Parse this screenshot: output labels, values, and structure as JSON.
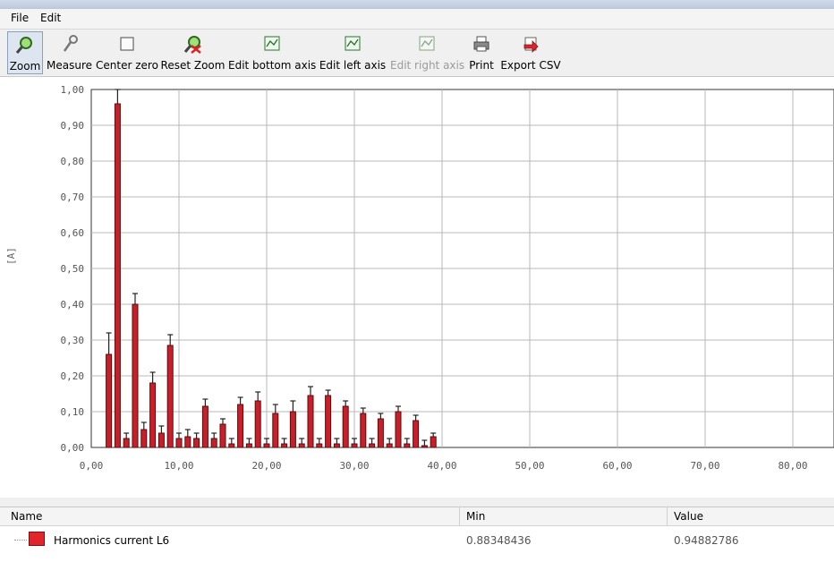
{
  "menu": {
    "file": "File",
    "edit": "Edit"
  },
  "toolbar": {
    "zoom": "Zoom",
    "measure": "Measure",
    "center_zero": "Center zero",
    "reset_zoom": "Reset Zoom",
    "edit_bottom_axis": "Edit bottom axis",
    "edit_left_axis": "Edit left axis",
    "edit_right_axis": "Edit right axis",
    "print": "Print",
    "export_csv": "Export CSV"
  },
  "chart_data": {
    "type": "bar",
    "ylabel": "[A]",
    "xlim": [
      0,
      85
    ],
    "ylim": [
      0,
      1.0
    ],
    "x_ticks": [
      "0,00",
      "10,00",
      "20,00",
      "30,00",
      "40,00",
      "50,00",
      "60,00",
      "70,00",
      "80,00"
    ],
    "y_ticks": [
      "0,00",
      "0,10",
      "0,20",
      "0,30",
      "0,40",
      "0,50",
      "0,60",
      "0,70",
      "0,80",
      "0,90",
      "1,00"
    ],
    "grid": true,
    "series": [
      {
        "name": "Harmonics current L6",
        "color": "#c8202a",
        "x": [
          2,
          3,
          4,
          5,
          6,
          7,
          8,
          9,
          10,
          11,
          12,
          13,
          14,
          15,
          16,
          17,
          18,
          19,
          20,
          21,
          22,
          23,
          24,
          25,
          26,
          27,
          28,
          29,
          30,
          31,
          32,
          33,
          34,
          35,
          36,
          37,
          38,
          39
        ],
        "values": [
          0.26,
          0.96,
          0.025,
          0.4,
          0.05,
          0.18,
          0.04,
          0.285,
          0.025,
          0.03,
          0.025,
          0.115,
          0.025,
          0.065,
          0.01,
          0.12,
          0.01,
          0.13,
          0.01,
          0.095,
          0.01,
          0.1,
          0.01,
          0.145,
          0.01,
          0.145,
          0.01,
          0.115,
          0.01,
          0.095,
          0.01,
          0.08,
          0.01,
          0.1,
          0.01,
          0.075,
          0.005,
          0.03
        ],
        "err": [
          0.06,
          0.04,
          0.015,
          0.03,
          0.02,
          0.03,
          0.02,
          0.03,
          0.015,
          0.02,
          0.015,
          0.02,
          0.015,
          0.015,
          0.015,
          0.02,
          0.015,
          0.025,
          0.015,
          0.025,
          0.015,
          0.03,
          0.015,
          0.025,
          0.015,
          0.015,
          0.015,
          0.015,
          0.015,
          0.015,
          0.015,
          0.015,
          0.015,
          0.015,
          0.015,
          0.015,
          0.015,
          0.01
        ]
      }
    ]
  },
  "legend": {
    "headers": {
      "name": "Name",
      "min": "Min",
      "value": "Value"
    },
    "rows": [
      {
        "name": "Harmonics current L6",
        "min": "0.88348436",
        "value": "0.94882786",
        "color": "#e0262b"
      }
    ]
  }
}
